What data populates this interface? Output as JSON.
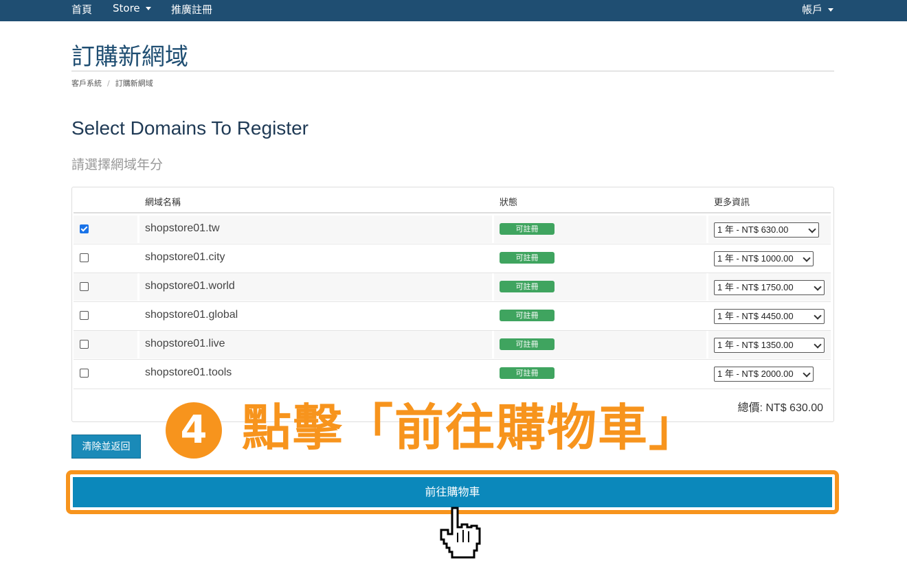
{
  "nav": {
    "home": "首頁",
    "store": "Store",
    "promo": "推廣註冊",
    "account": "帳戶"
  },
  "page": {
    "title": "訂購新網域",
    "breadcrumb": [
      "客戶系統",
      "訂購新網域"
    ]
  },
  "section": {
    "title": "Select Domains To Register",
    "subtitle": "請選擇網域年分"
  },
  "table": {
    "headers": [
      "網域名稱",
      "狀態",
      "更多資訊"
    ],
    "rows": [
      {
        "checked": true,
        "domain": "shopstore01.tw",
        "status": "可註冊",
        "option": "1 年 - NT$ 630.00"
      },
      {
        "checked": false,
        "domain": "shopstore01.city",
        "status": "可註冊",
        "option": "1 年 - NT$ 1000.00"
      },
      {
        "checked": false,
        "domain": "shopstore01.world",
        "status": "可註冊",
        "option": "1 年 - NT$ 1750.00"
      },
      {
        "checked": false,
        "domain": "shopstore01.global",
        "status": "可註冊",
        "option": "1 年 - NT$ 4450.00"
      },
      {
        "checked": false,
        "domain": "shopstore01.live",
        "status": "可註冊",
        "option": "1 年 - NT$ 1350.00"
      },
      {
        "checked": false,
        "domain": "shopstore01.tools",
        "status": "可註冊",
        "option": "1 年 - NT$ 2000.00"
      }
    ],
    "total": "總價: NT$ 630.00"
  },
  "buttons": {
    "clear": "清除並返回",
    "checkout": "前往購物車"
  },
  "annotation": {
    "number": "4",
    "text": "點擊「前往購物車」"
  },
  "colors": {
    "navbar": "#1f4e72",
    "accent_orange": "#f7941d",
    "primary_button": "#0b88bb",
    "status_badge": "#3fa45f"
  }
}
